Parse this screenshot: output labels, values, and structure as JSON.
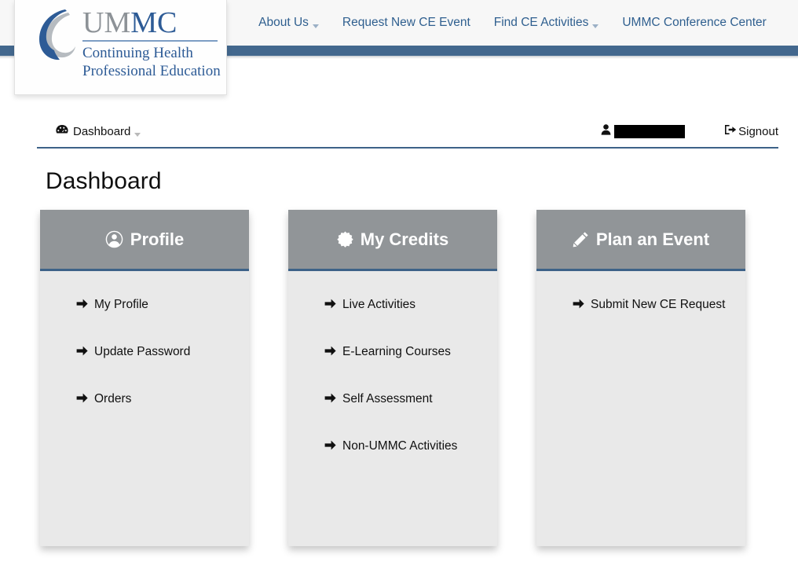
{
  "brand": {
    "logo_line1_gray": "UM",
    "logo_line1_blue": "MC",
    "logo_sub_line1": "Continuing Health",
    "logo_sub_line2": "Professional Education",
    "logo_mark_icon": "ummc-swirl-logo-icon",
    "accent_blue": "#43688e",
    "accent_link_blue": "#2f5f8f",
    "card_header_gray": "#919598",
    "card_body_gray": "#e9e9e9"
  },
  "nav": {
    "items": [
      {
        "label": "About Us",
        "has_dropdown": true
      },
      {
        "label": "Request New CE Event",
        "has_dropdown": false
      },
      {
        "label": "Find CE Activities",
        "has_dropdown": true
      },
      {
        "label": "UMMC Conference Center",
        "has_dropdown": false
      }
    ]
  },
  "user_bar": {
    "dashboard_label": "Dashboard",
    "dashboard_icon": "tachometer-icon",
    "dashboard_has_dropdown": true,
    "user_icon": "user-icon",
    "username": "",
    "username_redacted": true,
    "signout_label": "Signout",
    "signout_icon": "sign-out-icon"
  },
  "page": {
    "title": "Dashboard"
  },
  "cards": [
    {
      "title": "Profile",
      "icon": "user-circle-icon",
      "links": [
        {
          "label": "My Profile",
          "icon": "arrow-right-icon"
        },
        {
          "label": "Update Password",
          "icon": "arrow-right-icon"
        },
        {
          "label": "Orders",
          "icon": "arrow-right-icon"
        }
      ]
    },
    {
      "title": "My Credits",
      "icon": "certificate-icon",
      "links": [
        {
          "label": "Live Activities",
          "icon": "arrow-right-icon"
        },
        {
          "label": "E-Learning Courses",
          "icon": "arrow-right-icon"
        },
        {
          "label": "Self Assessment",
          "icon": "arrow-right-icon"
        },
        {
          "label": "Non-UMMC Activities",
          "icon": "arrow-right-icon"
        }
      ]
    },
    {
      "title": "Plan an Event",
      "icon": "pencil-icon",
      "links": [
        {
          "label": "Submit New CE Request",
          "icon": "arrow-right-icon"
        }
      ]
    }
  ]
}
